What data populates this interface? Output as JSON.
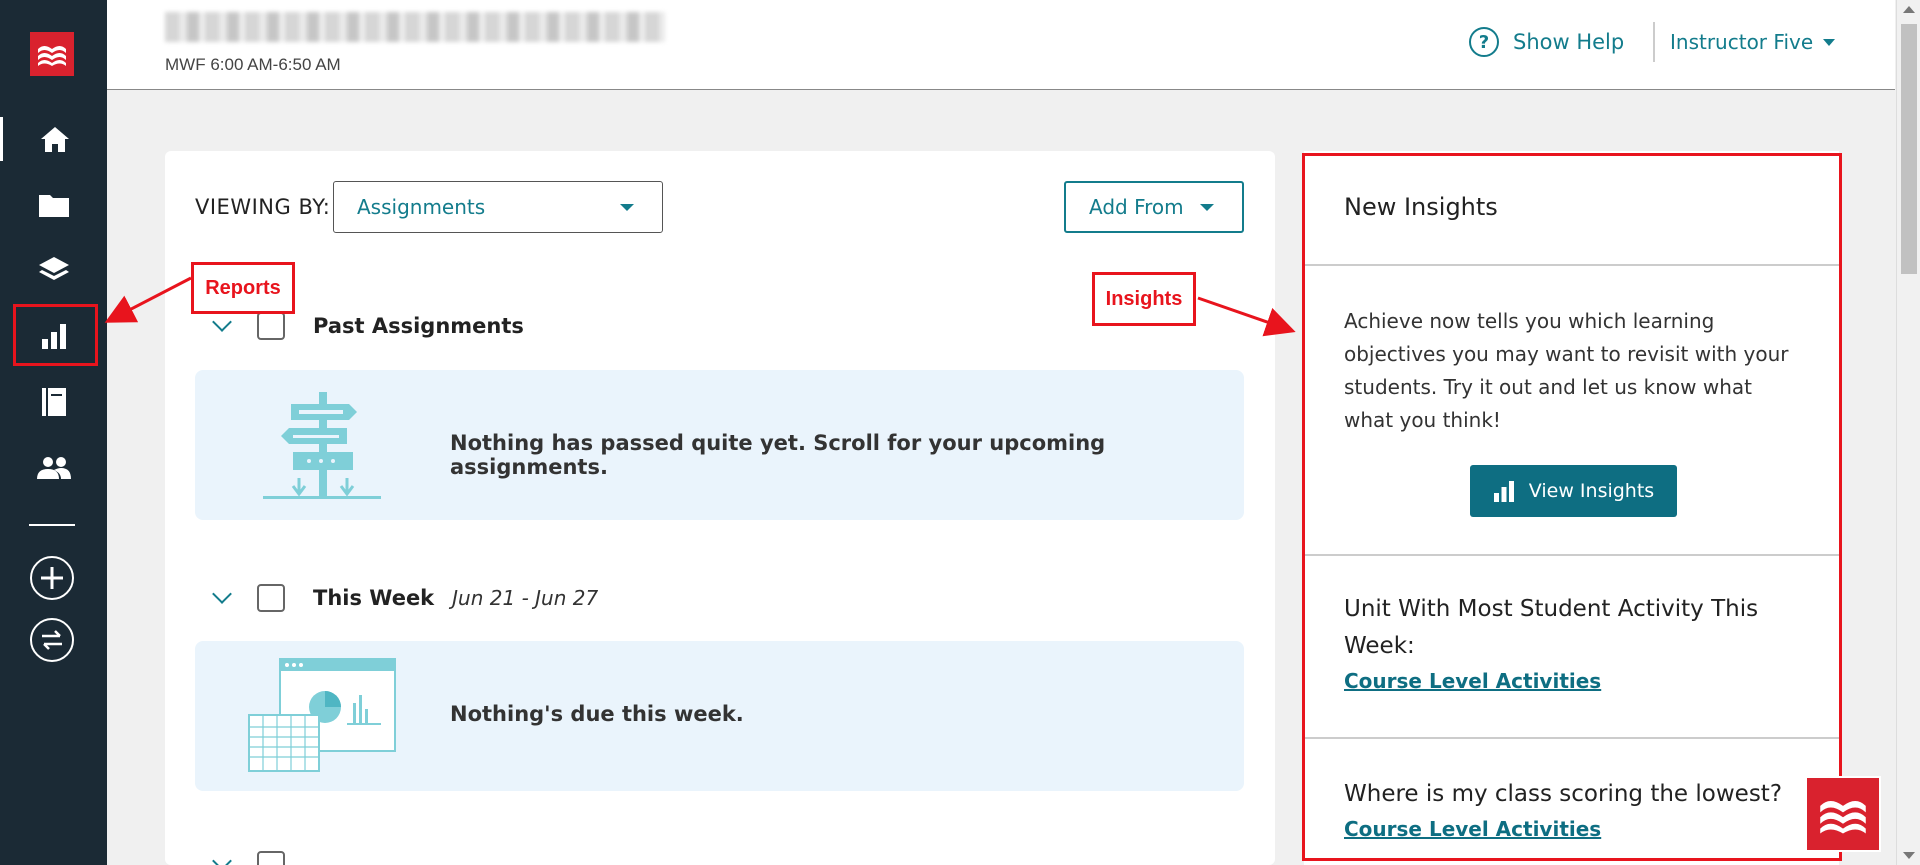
{
  "header": {
    "course_time": "MWF 6:00 AM-6:50 AM",
    "help_label": "Show Help",
    "user_label": "Instructor Five"
  },
  "sidebar": {
    "items": [
      {
        "icon": "home-icon"
      },
      {
        "icon": "folder-icon"
      },
      {
        "icon": "layers-icon"
      },
      {
        "icon": "bar-chart-icon"
      },
      {
        "icon": "notebook-icon"
      },
      {
        "icon": "people-icon"
      }
    ],
    "actions": [
      {
        "icon": "plus-icon"
      },
      {
        "icon": "switch-icon"
      }
    ]
  },
  "main": {
    "viewing_label": "VIEWING BY:",
    "viewing_value": "Assignments",
    "add_from_label": "Add From",
    "sections": [
      {
        "title": "Past Assignments",
        "dates": "",
        "message": "Nothing has passed quite yet. Scroll for your upcoming assignments."
      },
      {
        "title": "This Week",
        "dates": "Jun 21 - Jun 27",
        "message": "Nothing's due this week."
      }
    ]
  },
  "insights": {
    "title": "New Insights",
    "description": "Achieve now tells you which learning objectives you may want to revisit with your students. Try it out and let us know what what you think!",
    "button_label": "View Insights",
    "items": [
      {
        "question": "Unit With Most Student Activity This Week:",
        "link": "Course Level Activities"
      },
      {
        "question": "Where is my class scoring the lowest?",
        "link": "Course Level Activities"
      }
    ]
  },
  "annotations": {
    "reports_label": "Reports",
    "insights_label": "Insights"
  },
  "colors": {
    "sidebar_bg": "#1b2a35",
    "accent_teal": "#137c8c",
    "brand_red": "#d9222e",
    "annotation_red": "#e8141d",
    "empty_box_bg": "#eaf4fc"
  }
}
